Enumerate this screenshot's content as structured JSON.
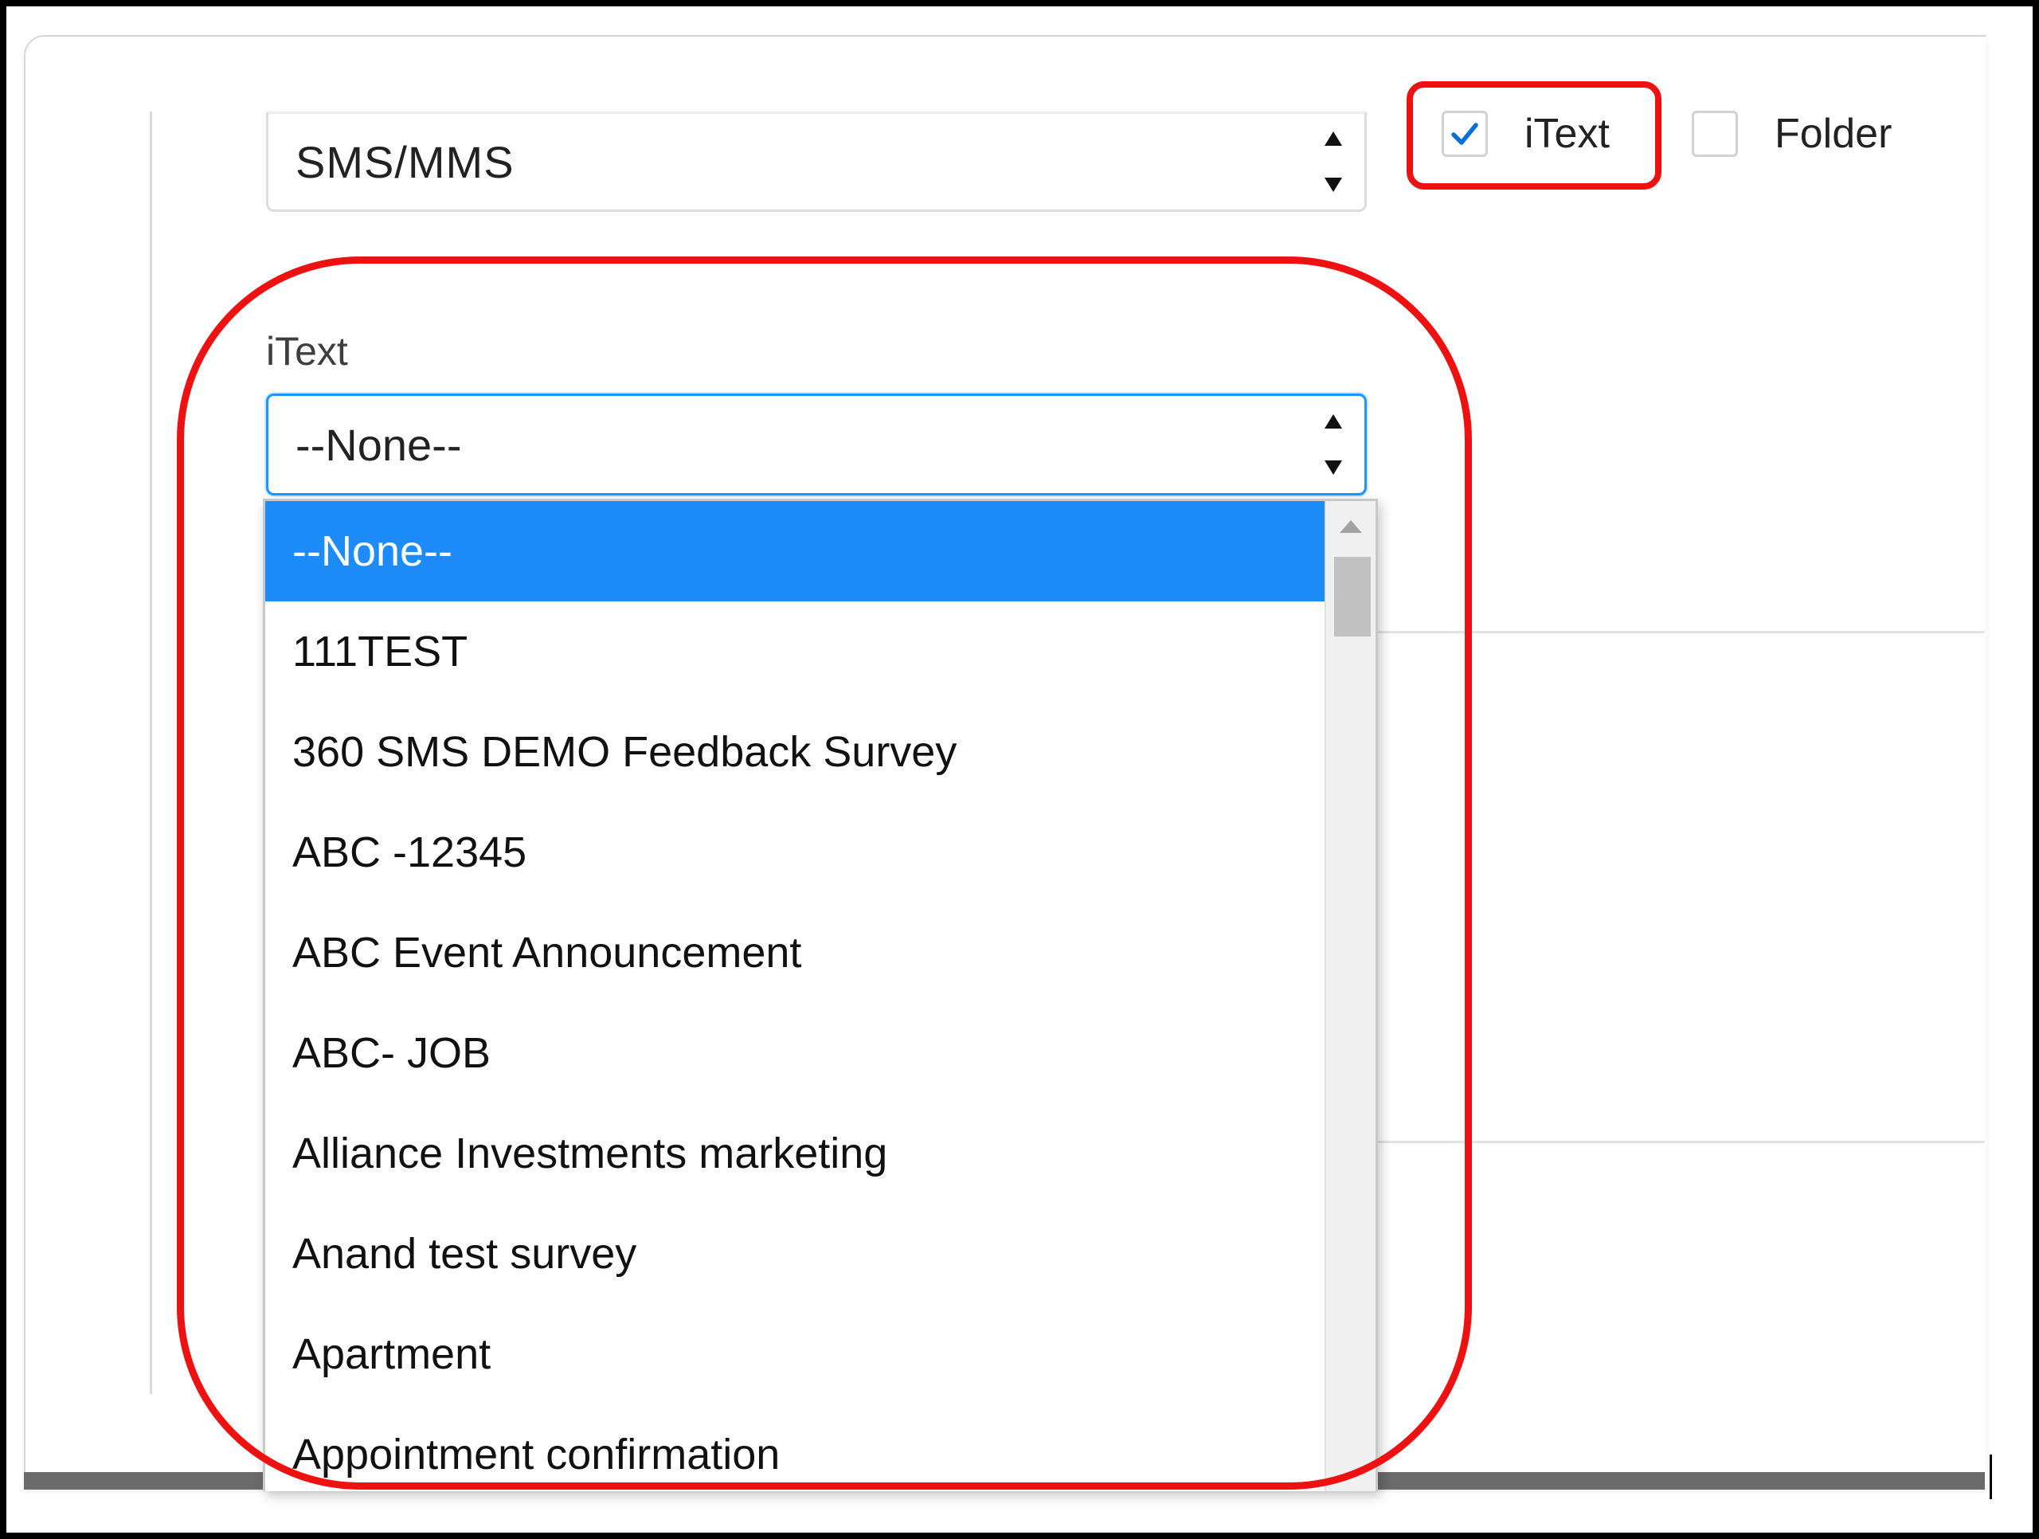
{
  "channel_select": {
    "value": "SMS/MMS"
  },
  "checkboxes": [
    {
      "label": "iText",
      "checked": true
    },
    {
      "label": "Folder",
      "checked": false
    }
  ],
  "itext_field": {
    "label": "iText",
    "value": "--None--"
  },
  "dropdown": {
    "selected_index": 0,
    "options": [
      "--None--",
      "111TEST",
      "360 SMS DEMO Feedback Survey",
      "ABC -12345",
      "ABC Event Announcement",
      "ABC- JOB",
      "Alliance Investments marketing",
      "Anand test survey",
      "Apartment",
      "Appointment confirmation"
    ]
  },
  "colors": {
    "selected_option_bg": "#1e8cf8",
    "focus_border": "#1b96ff",
    "checkmark": "#0a6fd8",
    "annotation_red": "#ee1111"
  },
  "icons": {
    "spinner": "up-down-arrows-icon",
    "checkmark": "checkmark-icon",
    "scroll_up": "scroll-up-arrow-icon"
  }
}
